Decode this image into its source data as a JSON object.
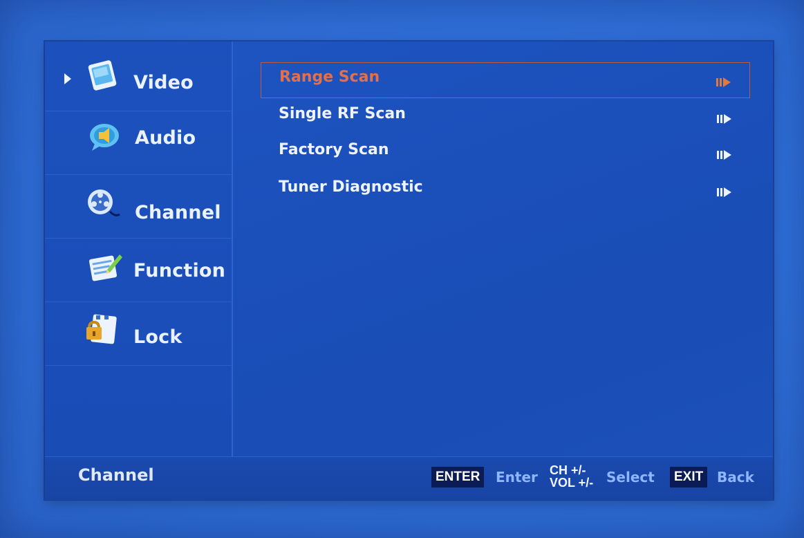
{
  "sidebar": {
    "items": [
      {
        "label": "Video",
        "icon": "video-icon",
        "active": true
      },
      {
        "label": "Audio",
        "icon": "audio-icon",
        "active": false
      },
      {
        "label": "Channel",
        "icon": "channel-icon",
        "active": false
      },
      {
        "label": "Function",
        "icon": "function-icon",
        "active": false
      },
      {
        "label": "Lock",
        "icon": "lock-icon",
        "active": false
      }
    ]
  },
  "menu": {
    "items": [
      {
        "label": "Range Scan",
        "selected": true,
        "icon": "submenu-arrow-icon"
      },
      {
        "label": "Single RF Scan",
        "selected": false,
        "icon": "submenu-arrow-icon"
      },
      {
        "label": "Factory Scan",
        "selected": false,
        "icon": "submenu-arrow-icon"
      },
      {
        "label": "Tuner Diagnostic",
        "selected": false,
        "icon": "submenu-arrow-icon"
      }
    ]
  },
  "footer": {
    "title": "Channel",
    "enter_key": "ENTER",
    "enter_label": "Enter",
    "ch_key": "CH +/-",
    "vol_key": "VOL +/-",
    "select_label": "Select",
    "exit_key": "EXIT",
    "back_label": "Back"
  },
  "colors": {
    "background": "#2f6fd9",
    "panel": "#1b4fba",
    "selected_text": "#e1704b",
    "selected_border": "#b85c3a",
    "footer_hint": "#8fb6ff"
  }
}
